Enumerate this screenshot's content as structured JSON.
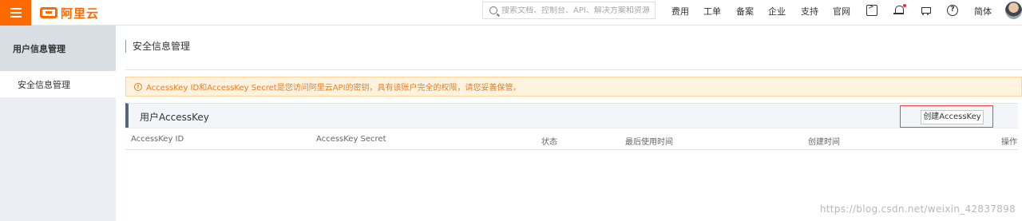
{
  "header": {
    "logo_text": "阿里云",
    "search_placeholder": "搜索文档、控制台、API、解决方案和资源",
    "nav": {
      "fees": "费用",
      "tickets": "工单",
      "beian": "备案",
      "enterprise": "企业",
      "support": "支持",
      "website": "官网",
      "language": "简体"
    },
    "icons": {
      "menu": "menu-icon",
      "terminal": "terminal-icon",
      "notifications": "bell-icon",
      "cart": "cart-icon",
      "help": "help-icon"
    },
    "accent_color": "#ff6a00"
  },
  "sidebar": {
    "title": "用户信息管理",
    "items": [
      {
        "label": "安全信息管理"
      }
    ]
  },
  "main": {
    "page_title": "安全信息管理",
    "alert": {
      "icon": "!",
      "text": "AccessKey ID和AccessKey Secret是您访问阿里云API的密钥，具有该账户完全的权限，请您妥善保管。"
    },
    "panel": {
      "title": "用户AccessKey",
      "create_button": "创建AccessKey"
    },
    "table": {
      "columns": [
        "AccessKey ID",
        "AccessKey Secret",
        "状态",
        "最后使用时间",
        "创建时间",
        "操作"
      ]
    }
  },
  "watermark": "https://blog.csdn.net/weixin_42837898"
}
